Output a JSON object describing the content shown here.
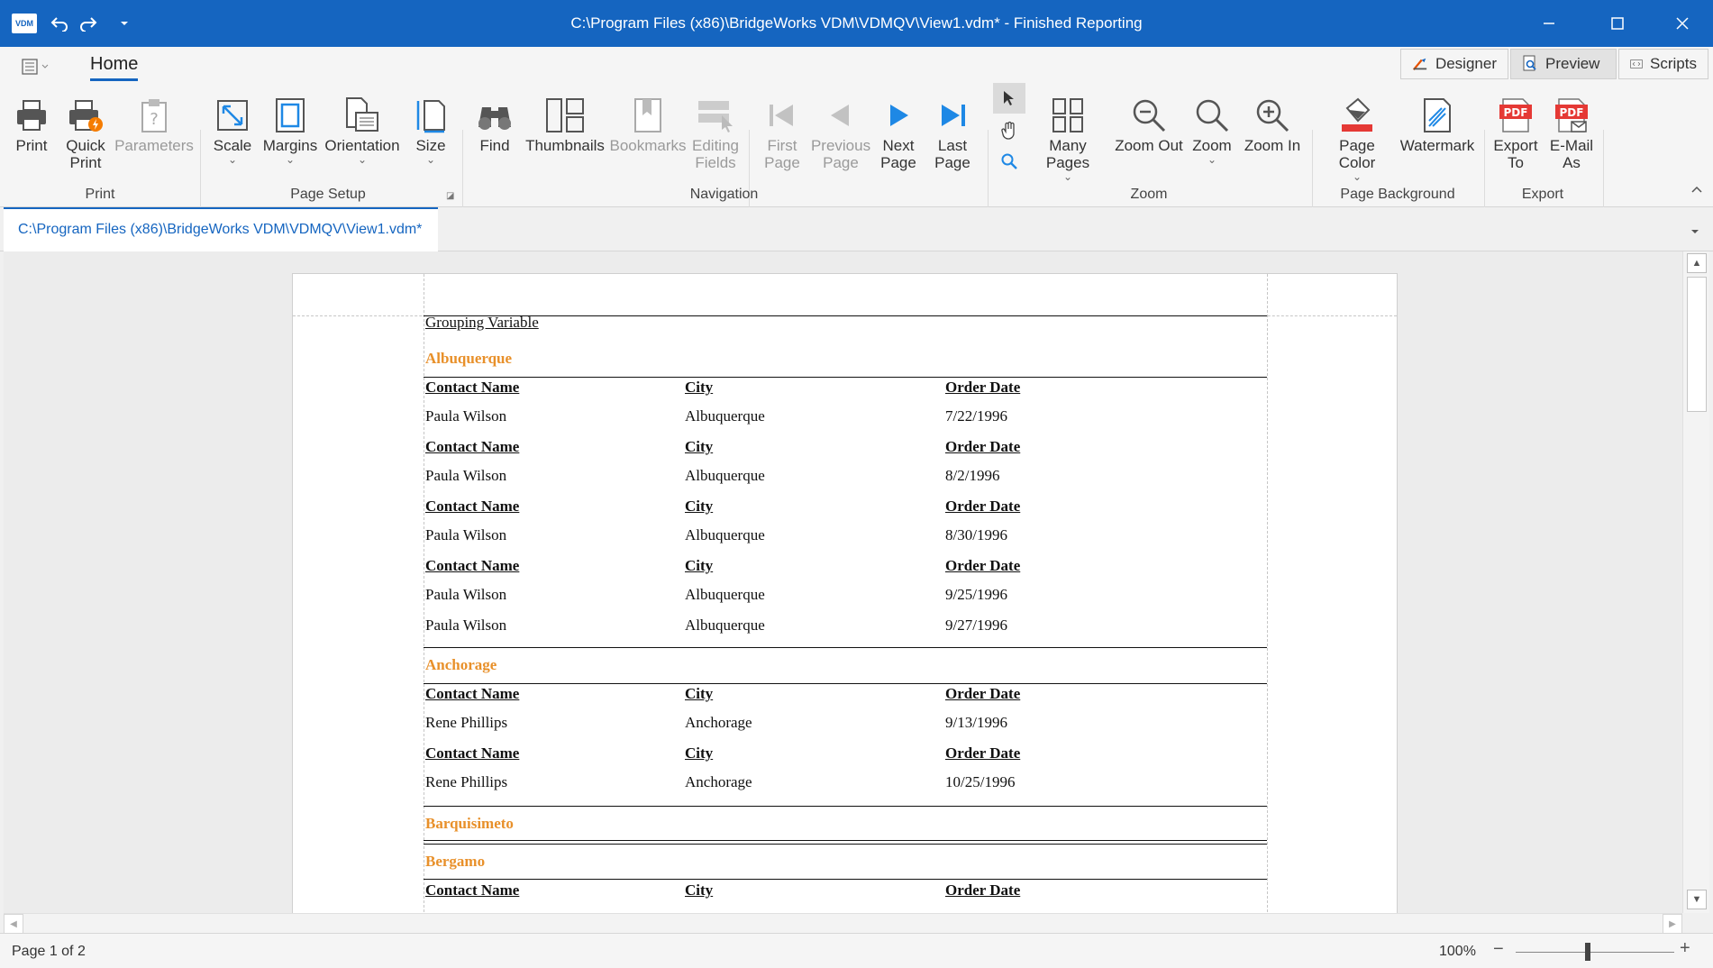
{
  "titlebar": {
    "logo": "VDM",
    "title": "C:\\Program Files (x86)\\BridgeWorks VDM\\VDMQV\\View1.vdm* - Finished Reporting"
  },
  "ribbon": {
    "tab": "Home",
    "views": [
      {
        "label": "Designer"
      },
      {
        "label": "Preview"
      },
      {
        "label": "Scripts"
      }
    ],
    "groups": {
      "print": "Print",
      "page_setup": "Page Setup",
      "navigation": "Navigation",
      "zoom": "Zoom",
      "page_background": "Page Background",
      "export": "Export"
    },
    "buttons": {
      "print": "Print",
      "quick_print_1": "Quick",
      "quick_print_2": "Print",
      "parameters": "Parameters",
      "scale": "Scale",
      "margins": "Margins",
      "orientation": "Orientation",
      "size": "Size",
      "find": "Find",
      "thumbnails": "Thumbnails",
      "bookmarks": "Bookmarks",
      "editing_1": "Editing",
      "editing_2": "Fields",
      "first_1": "First",
      "first_2": "Page",
      "prev_1": "Previous",
      "prev_2": "Page",
      "next_1": "Next",
      "next_2": "Page",
      "last_1": "Last",
      "last_2": "Page",
      "many_pages": "Many Pages",
      "zoom_out": "Zoom Out",
      "zoom": "Zoom",
      "zoom_in": "Zoom In",
      "page_color": "Page Color",
      "watermark": "Watermark",
      "export_1": "Export",
      "export_2": "To",
      "email_1": "E-Mail",
      "email_2": "As",
      "pdf": "PDF"
    }
  },
  "doc_tab": "C:\\Program Files (x86)\\BridgeWorks VDM\\VDMQV\\View1.vdm*",
  "report": {
    "grouping_variable": "Grouping Variable",
    "col_contact": "Contact Name",
    "col_city": "City",
    "col_date": "Order Date",
    "groups": [
      {
        "city": "Albuquerque",
        "rows": [
          {
            "contact": "Paula Wilson",
            "city": "Albuquerque",
            "date": "7/22/1996"
          },
          {
            "contact": "Paula Wilson",
            "city": "Albuquerque",
            "date": "8/2/1996"
          },
          {
            "contact": "Paula Wilson",
            "city": "Albuquerque",
            "date": "8/30/1996"
          },
          {
            "contact": "Paula Wilson",
            "city": "Albuquerque",
            "date": "9/25/1996"
          },
          {
            "contact": "Paula Wilson",
            "city": "Albuquerque",
            "date": "9/27/1996"
          }
        ]
      },
      {
        "city": "Anchorage",
        "rows": [
          {
            "contact": "Rene Phillips",
            "city": "Anchorage",
            "date": "9/13/1996"
          },
          {
            "contact": "Rene Phillips",
            "city": "Anchorage",
            "date": "10/25/1996"
          }
        ]
      },
      {
        "city": "Barquisimeto",
        "rows": []
      },
      {
        "city": "Bergamo",
        "rows": []
      }
    ]
  },
  "status": {
    "page": "Page 1 of 2",
    "zoom": "100%",
    "zoom_level_percent": 100
  },
  "colors": {
    "accent": "#1565c0",
    "group_heading": "#e8902a"
  }
}
